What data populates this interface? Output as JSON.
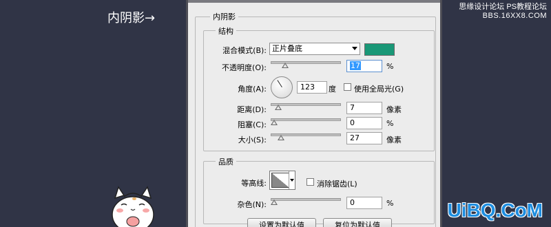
{
  "caption": "内阴影→",
  "watermark": {
    "line1": "思缘设计论坛  PS教程论坛",
    "line2": "BBS.16XX8.COM"
  },
  "uibq": "UiBQ.CoM",
  "dialog": {
    "group_title": "内阴影",
    "structure": {
      "title": "结构",
      "blend_mode_label": "混合模式(B):",
      "blend_mode_value": "正片叠底",
      "blend_color": "#1a9877",
      "opacity_label": "不透明度(O):",
      "opacity_value": "17",
      "opacity_unit": "%",
      "opacity_fraction": 0.17,
      "angle_label": "角度(A):",
      "angle_value": "123",
      "angle_unit": "度",
      "global_light_label": "使用全局光(G)",
      "global_light_checked": false,
      "distance_label": "距离(D):",
      "distance_value": "7",
      "distance_unit": "像素",
      "distance_fraction": 0.07,
      "choke_label": "阻塞(C):",
      "choke_value": "0",
      "choke_unit": "%",
      "choke_fraction": 0.0,
      "size_label": "大小(S):",
      "size_value": "27",
      "size_unit": "像素",
      "size_fraction": 0.11
    },
    "quality": {
      "title": "品质",
      "contour_label": "等高线:",
      "antialias_label": "消除锯齿(L)",
      "antialias_checked": false,
      "noise_label": "杂色(N):",
      "noise_value": "0",
      "noise_unit": "%",
      "noise_fraction": 0.0
    },
    "buttons": {
      "set_default": "设置为默认值",
      "reset_default": "复位为默认值"
    }
  }
}
